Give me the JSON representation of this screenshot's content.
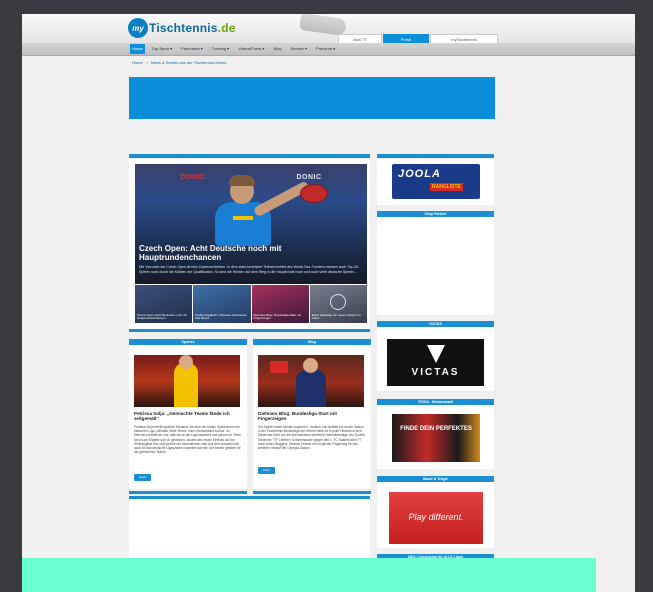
{
  "site": {
    "logo_prefix": "my",
    "logo_name": "Tischtennis",
    "logo_tld": ".de"
  },
  "portal_tabs": [
    {
      "label": "click TT",
      "active": false
    },
    {
      "label": "Portal",
      "active": true
    },
    {
      "label": "myTischtennis",
      "active": false
    }
  ],
  "nav": [
    {
      "label": "Home",
      "active": true
    },
    {
      "label": "Top-Sport ▾",
      "active": false
    },
    {
      "label": "Panorama ▾",
      "active": false
    },
    {
      "label": "Training ▾",
      "active": false
    },
    {
      "label": "Videos/Fotos ▾",
      "active": false
    },
    {
      "label": "Blog",
      "active": false
    },
    {
      "label": "Service ▾",
      "active": false
    },
    {
      "label": "Premium ▾",
      "active": false
    }
  ],
  "breadcrumb": {
    "home": "Home",
    "sep": "»",
    "current": "News & Stories aus der Tischtennis-Szene"
  },
  "hero": {
    "ad_left": "DONIC",
    "ad_right": "DONIC",
    "title": "Czech Open: Acht Deutsche noch mit Hauptrundenchancen",
    "text": "Die Vorrunde der Czech Open ist kein Zuckerschlecken. In dem stark besetzten Teilnehmerfeld des World-Tour-Turniers müssen auch Top-30-Spieler noch durch die Mühlen der Qualifikation. So sind die Hürden auf dem Weg in die Hauptrunde hoch und auch viele deutsche Spieler..."
  },
  "thumbs": [
    {
      "caption": "Czech Open: Acht Deutsche noch mit Hauptrundenchancen"
    },
    {
      "caption": "Fiedls Ausgleich: Chinesen dominieren das Mixed"
    },
    {
      "caption": "Dietmars Blog: Bundesliga-Start mit Fingerzeigen"
    },
    {
      "caption": "Erste Spieltage der neuen Saison im Video"
    }
  ],
  "cards": [
    {
      "header": "Sportes",
      "title": "Petrissa Solja: „Gemischte Teams fände ich zeitgemäß“",
      "text": "Petrissa Solja betritt sportlich Neuland. Als eine der ersten Spielerinnen der indischen Liga „Ultimate Table Tennis“ nach Deutschland zurück. Im Interview erzählt sie uns, was sie an der Liga fasziniert und warum ihr Team schon am Ehrgeiz sich zu gewinnen, dosiert des neuen Einfluss auf die Weltrangliste hat, und welche der Innovationen man aus dem Ausland sich auch für das deutsche Ligasystem vorstellen könnte. Am besten gefallen ihr die gemischten Teams.",
      "button": "lesen"
    },
    {
      "header": "Blog",
      "title": "Dietmars Blog: Bundesliga-Start mit Fingerzeigen",
      "text": "Die Spiele haben wieder begonnen - endlich. Der Auftakt zur neuen Saison in der Tischtennis-Bundesliga der Herren hatte es in jeder Hinsicht in sich. Dabei war nicht nur die überraschend deutliche Heimniederlage von Double-Gewinner TTF Liebherr Ochsenhausen gegen den 1. FC Saarbrücken TT auch unser Bloggers. Dietmar Kramer ein möglicher Fingerzeig für den weiteren Verlauf der Olympia-Saison.",
      "button": "lesen"
    }
  ],
  "sidebar": {
    "joola_brand": "JOOLA",
    "joola_sub": "RANGLISTE",
    "shop_header": "Shop Partner",
    "victas_header": "VICTAS",
    "victas_brand": "VICTAS",
    "stiga_header": "STIGA - Holzauswahl",
    "stiga_text": "FINDE DEIN PERFEKTES",
    "belag_header": "Bauer & Träger",
    "belag_text": "Play different.",
    "bottom_header": "NEU: Livescoring für ALLE Ligen"
  }
}
